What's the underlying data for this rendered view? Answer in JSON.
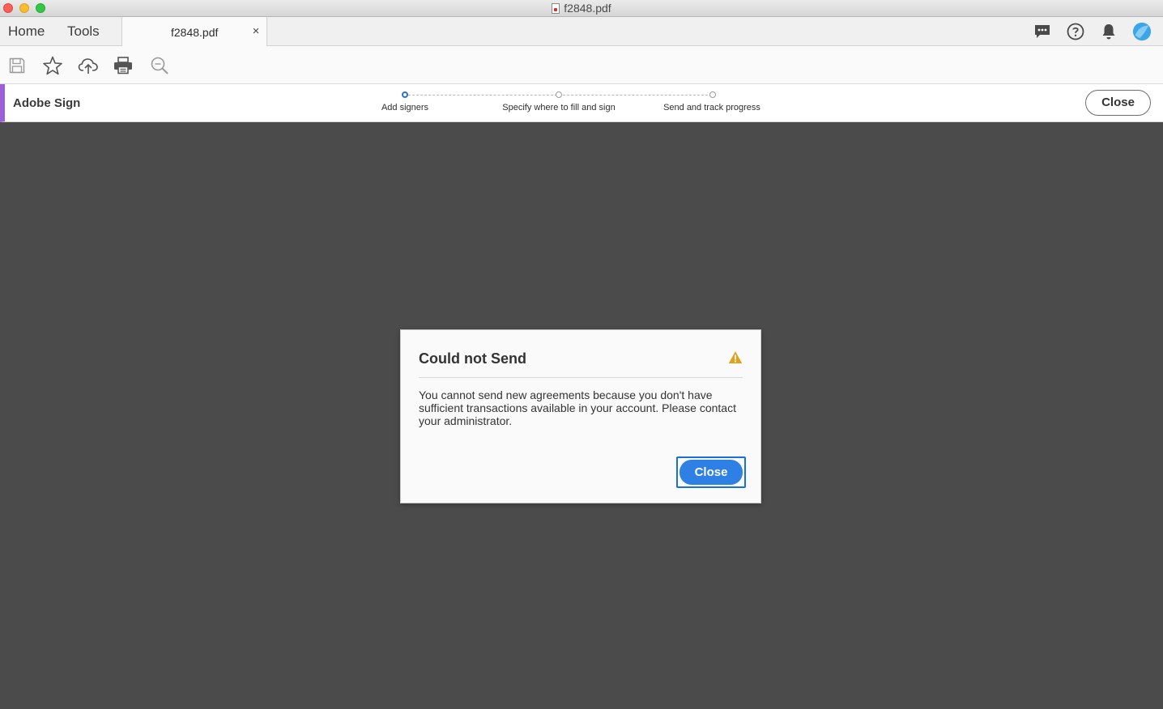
{
  "window": {
    "title": "f2848.pdf"
  },
  "tabs": {
    "home": "Home",
    "tools": "Tools",
    "document": "f2848.pdf",
    "close_glyph": "×"
  },
  "header_icons": [
    "comment-icon",
    "help-icon",
    "bell-icon",
    "profile-icon"
  ],
  "toolbar": {
    "icons": [
      "save-icon",
      "star-icon",
      "cloud-upload-icon",
      "print-icon",
      "search-zoom-icon"
    ]
  },
  "sign_bar": {
    "title": "Adobe Sign",
    "steps": [
      {
        "label": "Add signers",
        "active": true
      },
      {
        "label": "Specify where to fill and sign",
        "active": false
      },
      {
        "label": "Send and track progress",
        "active": false
      }
    ],
    "close_label": "Close",
    "accent_color": "#9c5fd6"
  },
  "dialog": {
    "title": "Could not Send",
    "message": "You cannot send new agreements because you don't have sufficient transactions available in your account. Please contact your administrator.",
    "button_label": "Close",
    "icon": "warning-icon",
    "button_color": "#2f80e5",
    "warning_color": "#e0a21c"
  }
}
